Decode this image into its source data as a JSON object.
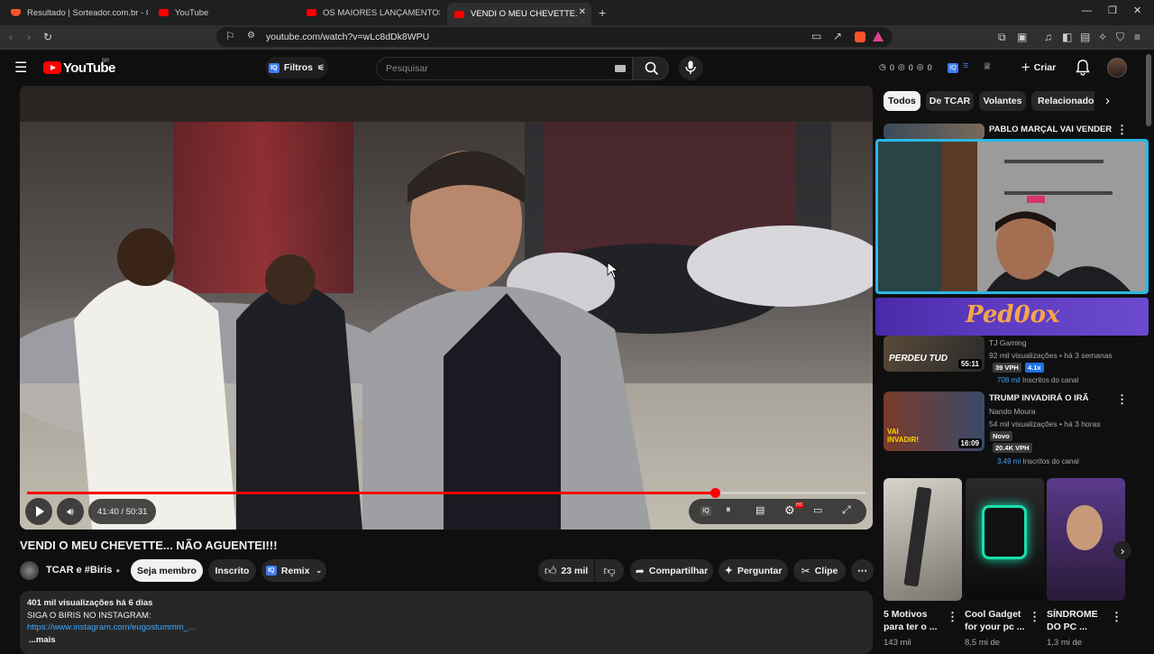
{
  "browser": {
    "tabs": [
      {
        "title": "Resultado | Sorteador.com.br - O Site"
      },
      {
        "title": "YouTube"
      },
      {
        "title": "OS MAIORES LANÇAMENTOS DO CI"
      },
      {
        "title": "VENDI O MEU CHEVETTE... NÃO"
      }
    ],
    "url": "youtube.com/watch?v=wLc8dDk8WPU"
  },
  "header": {
    "logo_text": "YouTube",
    "country": "BR",
    "filters_label": "Filtros",
    "search_placeholder": "Pesquisar",
    "stats": [
      "0",
      "0",
      "0"
    ],
    "create_label": "Criar"
  },
  "player": {
    "time": "41:40 / 50:31",
    "progress": 0.82
  },
  "video": {
    "title": "VENDI O MEU CHEVETTE... NÃO AGUENTEI!!!",
    "channel": "TCAR e #Biris",
    "join_label": "Seja membro",
    "subscribed_label": "Inscrito",
    "remix_label": "Remix",
    "likes": "23 mil",
    "share_label": "Compartilhar",
    "ask_label": "Perguntar",
    "clip_label": "Clipe"
  },
  "description": {
    "stats": "401 mil visualizações  há 6 dias",
    "line1": "SIGA O BIRIS NO INSTAGRAM:",
    "link": "https://www.instagram.com/eugostummm_...",
    "more": "...mais"
  },
  "chips": [
    "Todos",
    "De TCAR",
    "Volantes",
    "Relacionados"
  ],
  "recommendations": [
    {
      "title": "PABLO MARÇAL VAI VENDER"
    },
    {
      "title": "",
      "channel": "TJ Gaming",
      "views": "92 mil visualizações • há 3 semanas",
      "vph": "39 VPH",
      "mult": "4.1x",
      "subs_count": "708 mil",
      "subs_label": "Inscritos do canal",
      "thumb_text": "PERDEU TUD",
      "duration": "55:11"
    },
    {
      "title": "TRUMP INVADIRÁ O IRÃ",
      "channel": "Nando Moura",
      "views": "54 mil visualizações • há 3 horas",
      "badge": "Novo",
      "vph": "20.4K VPH",
      "subs_count": "3,49 mi",
      "subs_label": "Inscritos do canal",
      "thumb_text": "VAI INVADIR!",
      "duration": "16:09"
    }
  ],
  "shorts": [
    {
      "title": "5 Motivos para ter o ...",
      "views": "143 mil"
    },
    {
      "title": "Cool Gadget for your pc ...",
      "views": "8,5 mi de"
    },
    {
      "title": "SÍNDROME DO PC ...",
      "views": "1,3 mi de"
    }
  ],
  "overlay": {
    "brand": "Ped0ox"
  },
  "colors": {
    "accent": "#ff0000",
    "link": "#3ea6ff",
    "overlay_border": "#2bb8e6"
  }
}
